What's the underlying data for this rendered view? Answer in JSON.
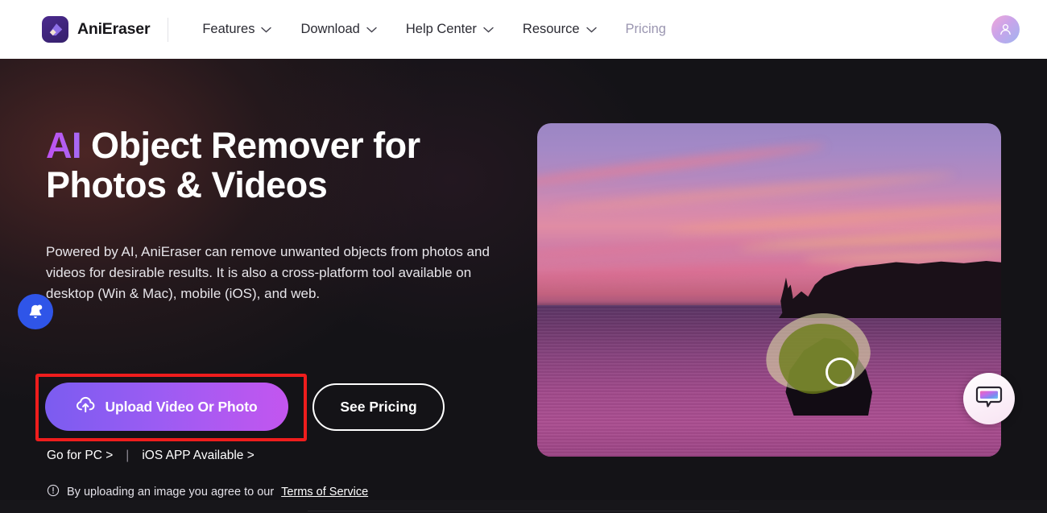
{
  "nav": {
    "brand": "AniEraser",
    "logo_icon": "eraser-logo-icon",
    "items": [
      {
        "label": "Features",
        "has_dropdown": true,
        "muted": false
      },
      {
        "label": "Download",
        "has_dropdown": true,
        "muted": false
      },
      {
        "label": "Help Center",
        "has_dropdown": true,
        "muted": false
      },
      {
        "label": "Resource",
        "has_dropdown": true,
        "muted": false
      },
      {
        "label": "Pricing",
        "has_dropdown": false,
        "muted": true
      }
    ],
    "avatar_icon": "user-avatar-icon"
  },
  "hero": {
    "headline_accent": "AI",
    "headline_rest": " Object Remover for Photos & Videos",
    "subcopy": "Powered by AI, AniEraser can remove unwanted objects from photos and videos for desirable results. It is also a cross-platform tool available on desktop (Win & Mac), mobile (iOS), and web.",
    "notification_icon": "bell-icon",
    "upload_button": {
      "label": "Upload Video Or Photo",
      "icon": "cloud-upload-icon"
    },
    "pricing_button": {
      "label": "See Pricing"
    },
    "links": [
      {
        "label": "Go for PC >"
      },
      {
        "label": "iOS APP Available >"
      }
    ],
    "link_separator": "|",
    "terms": {
      "icon": "info-exclamation-icon",
      "text": "By uploading an image you agree to our ",
      "link": "Terms of Service"
    },
    "preview": {
      "alt": "Sunset seascape with cliff, ocean and a rock masked with a green selection brush",
      "mask_color": "#6c7e18",
      "cursor_icon": "brush-cursor-ring"
    }
  },
  "annotation": {
    "type": "highlight-rectangle",
    "color": "#ef1d1d"
  },
  "chat_widget": {
    "icon": "chat-bubble-icon",
    "label": ""
  },
  "colors": {
    "accent_purple": "#b455f2",
    "gradient_start": "#7b5cf0",
    "gradient_end": "#c356ef",
    "page_background": "#17161a",
    "nav_background": "#ffffff",
    "annotation_red": "#ef1d1d",
    "bell_blue": "#2f55e8"
  }
}
